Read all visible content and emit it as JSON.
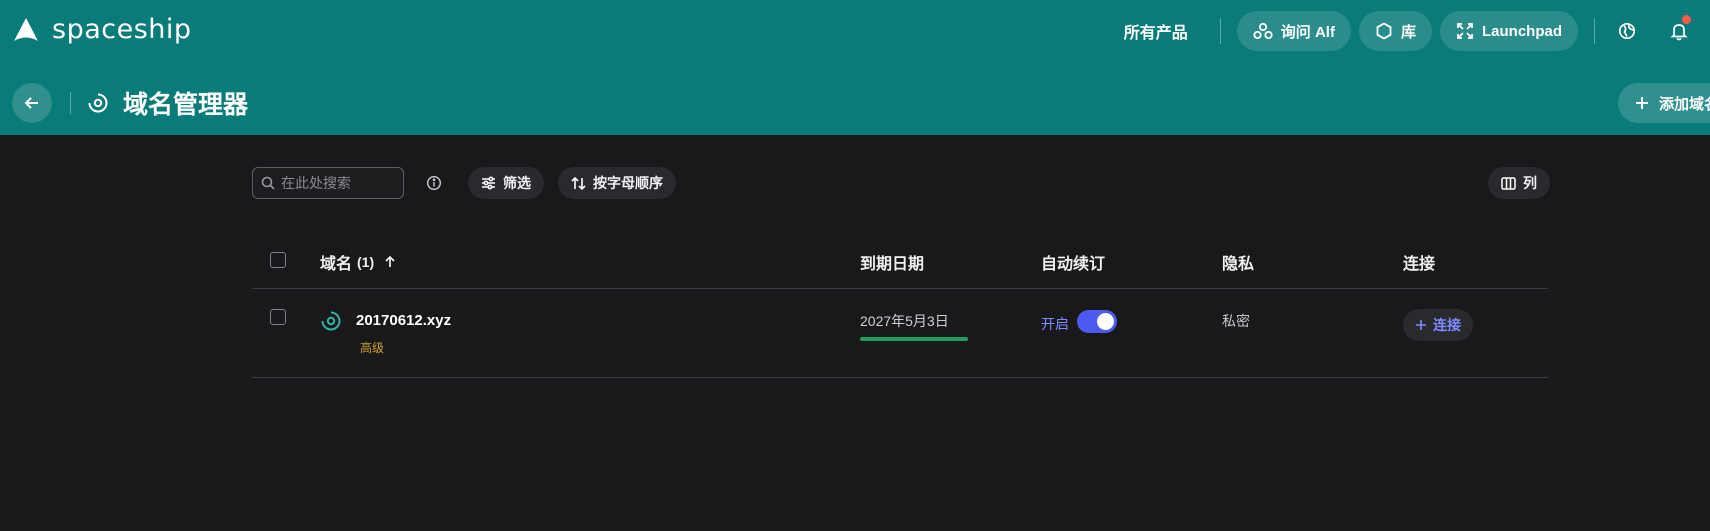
{
  "brand": {
    "name": "spaceship"
  },
  "nav": {
    "all_products": "所有产品",
    "ask_alf": "询问 Alf",
    "library": "库",
    "launchpad": "Launchpad"
  },
  "page": {
    "title": "域名管理器",
    "add_domain_label": "添加域名"
  },
  "toolbar": {
    "search_placeholder": "在此处搜索",
    "filter_label": "筛选",
    "sort_label": "按字母顺序",
    "columns_label": "列"
  },
  "table": {
    "headers": {
      "domain": "域名",
      "domain_count": "(1)",
      "expiry": "到期日期",
      "auto_renew": "自动续订",
      "privacy": "隐私",
      "connect": "连接"
    },
    "rows": [
      {
        "domain": "20170612.xyz",
        "tag": "高级",
        "expiry_date": "2027年5月3日",
        "auto_renew_state": "开启",
        "auto_renew_on": true,
        "privacy": "私密",
        "connect_label": "连接"
      }
    ]
  },
  "colors": {
    "header_teal": "#097b78",
    "background": "#19191b",
    "accent_blue": "#4d59f0",
    "link_blue": "#7d8cff",
    "expiry_green": "#1f9d5b",
    "tag_gold": "#c9a227",
    "notification_red": "#ff5a45"
  }
}
